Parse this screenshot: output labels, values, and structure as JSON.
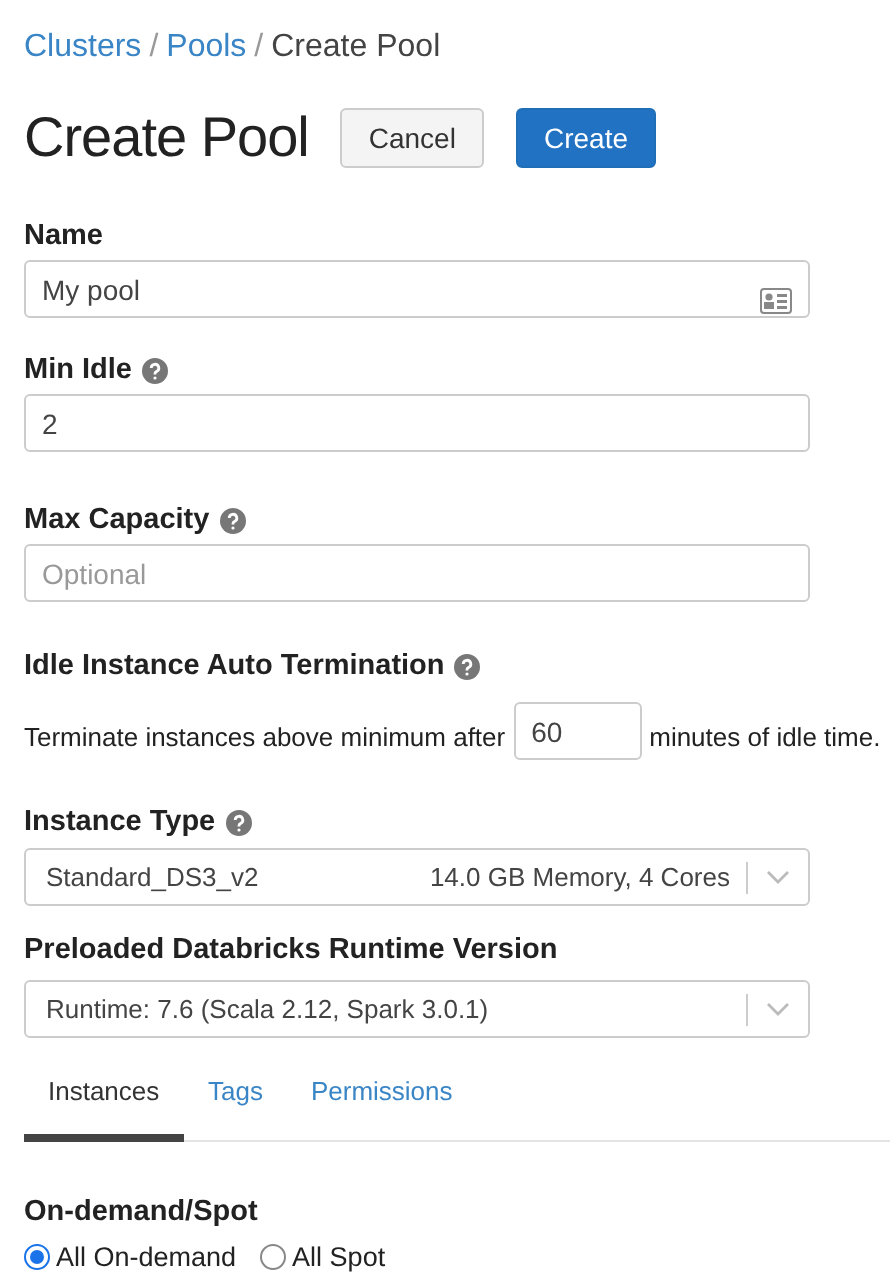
{
  "breadcrumb_separator": "/",
  "breadcrumb": [
    {
      "label": "Clusters",
      "kind": "link"
    },
    {
      "label": "Pools",
      "kind": "link"
    },
    {
      "label": "Create Pool",
      "kind": "current"
    }
  ],
  "title": "Create Pool",
  "buttons": [
    {
      "label": "Cancel",
      "kind": "secondary"
    },
    {
      "label": "Create",
      "kind": "primary"
    }
  ],
  "name_field": {
    "label": "Name",
    "value": "My pool"
  },
  "min_idle": {
    "label": "Min Idle",
    "value": "2"
  },
  "max_capacity": {
    "label": "Max Capacity",
    "placeholder": "Optional"
  },
  "auto_termination": {
    "label": "Idle Instance Auto Termination",
    "before": "Terminate instances above minimum after",
    "value": "60",
    "after": "minutes of idle time."
  },
  "instance_type": {
    "label": "Instance Type",
    "value": "Standard_DS3_v2",
    "detail": "14.0 GB Memory, 4 Cores"
  },
  "runtime": {
    "label": "Preloaded Databricks Runtime Version",
    "value": "Runtime: 7.6 (Scala 2.12, Spark 3.0.1)"
  },
  "tabs": [
    {
      "label": "Instances",
      "selected": true
    },
    {
      "label": "Tags",
      "selected": false
    },
    {
      "label": "Permissions",
      "selected": false
    }
  ],
  "on_demand_spot": {
    "label": "On-demand/Spot",
    "options": [
      {
        "label": "All On-demand",
        "selected": true
      },
      {
        "label": "All Spot",
        "selected": false
      }
    ]
  }
}
